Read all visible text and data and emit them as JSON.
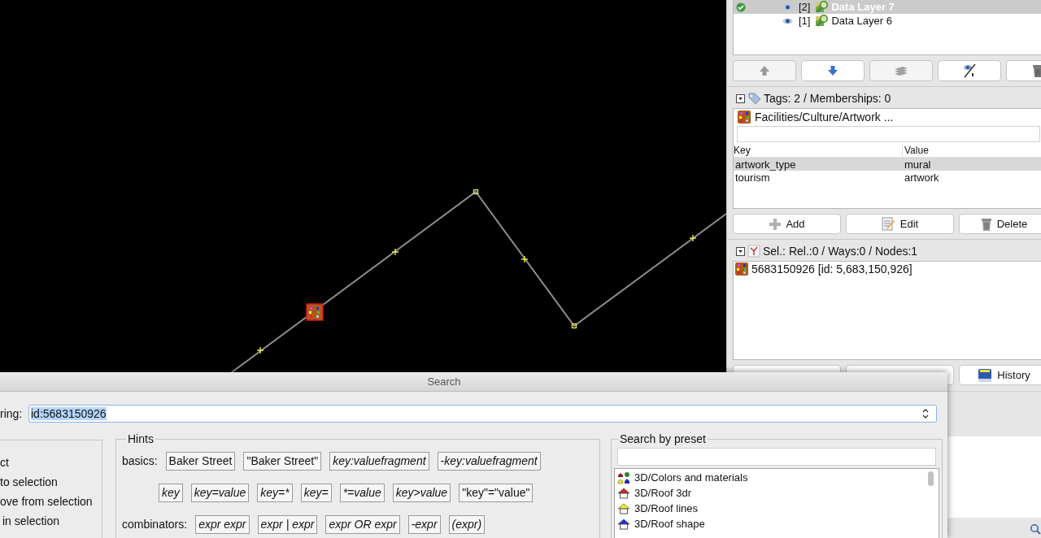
{
  "layers": {
    "rows": [
      {
        "index": "[2]",
        "name": "Data Layer 7",
        "selected": true,
        "active": true
      },
      {
        "index": "[1]",
        "name": "Data Layer 6",
        "selected": false,
        "active": false
      }
    ],
    "buttons": [
      {
        "kind": "up",
        "disabled": true
      },
      {
        "kind": "down",
        "disabled": false
      },
      {
        "kind": "merge",
        "disabled": true
      },
      {
        "kind": "visibility",
        "disabled": false
      },
      {
        "kind": "delete",
        "disabled": false
      }
    ]
  },
  "tags": {
    "header": "Tags: 2 / Memberships: 0",
    "expanded": true,
    "preset": "Facilities/Culture/Artwork ...",
    "columns": [
      "Key",
      "Value"
    ],
    "rows": [
      {
        "key": "artwork_type",
        "value": "mural",
        "selected": true
      },
      {
        "key": "tourism",
        "value": "artwork",
        "selected": false
      }
    ],
    "buttons": [
      {
        "kind": "add",
        "label": "Add"
      },
      {
        "kind": "edit",
        "label": "Edit"
      },
      {
        "kind": "delete",
        "label": "Delete"
      }
    ]
  },
  "selection": {
    "header": "Sel.: Rel.:0 / Ways:0 / Nodes:1",
    "expanded": true,
    "items": [
      {
        "label": "5683150926 [id: 5,683,150,926]"
      }
    ],
    "buttons": [
      {
        "kind": "dropdown"
      },
      {
        "kind": "dropdown"
      },
      {
        "kind": "history",
        "label": "History"
      }
    ]
  },
  "search_dialog": {
    "title": "Search",
    "field_label": "ring:",
    "value": "id:5683150926",
    "modes": [
      "ct",
      "to selection",
      "ove from selection",
      "in selection"
    ],
    "hints": {
      "title": "Hints",
      "rows": [
        {
          "label": "basics:",
          "chips": [
            {
              "text": "Baker Street",
              "kind": "literal"
            },
            {
              "text": "\"Baker Street\"",
              "kind": "literal"
            },
            {
              "text": "key:valuefragment",
              "kind": "pattern"
            },
            {
              "text": "-key:valuefragment",
              "kind": "pattern"
            }
          ]
        },
        {
          "chips": [
            {
              "text": "key",
              "kind": "pattern"
            },
            {
              "text": "key=value",
              "kind": "pattern"
            },
            {
              "text": "key=*",
              "kind": "pattern"
            },
            {
              "text": "key=",
              "kind": "pattern"
            },
            {
              "text": "*=value",
              "kind": "pattern"
            },
            {
              "text": "key>value",
              "kind": "pattern"
            },
            {
              "text": "\"key\"=\"value\"",
              "kind": "literal"
            }
          ]
        },
        {
          "label": "combinators:",
          "chips": [
            {
              "text": "expr expr",
              "kind": "pattern"
            },
            {
              "text": "expr | expr",
              "kind": "pattern"
            },
            {
              "text": "expr OR expr",
              "kind": "pattern"
            },
            {
              "text": "-expr",
              "kind": "pattern"
            },
            {
              "text": "(expr)",
              "kind": "pattern"
            }
          ]
        }
      ]
    },
    "preset_search": {
      "title": "Search by preset",
      "items": [
        {
          "label": "3D/Colors and materials",
          "kind": "colors"
        },
        {
          "label": "3D/Roof 3dr",
          "kind": "roof-red"
        },
        {
          "label": "3D/Roof lines",
          "kind": "roof-yellow"
        },
        {
          "label": "3D/Roof shape",
          "kind": "roof-blue"
        }
      ]
    }
  }
}
